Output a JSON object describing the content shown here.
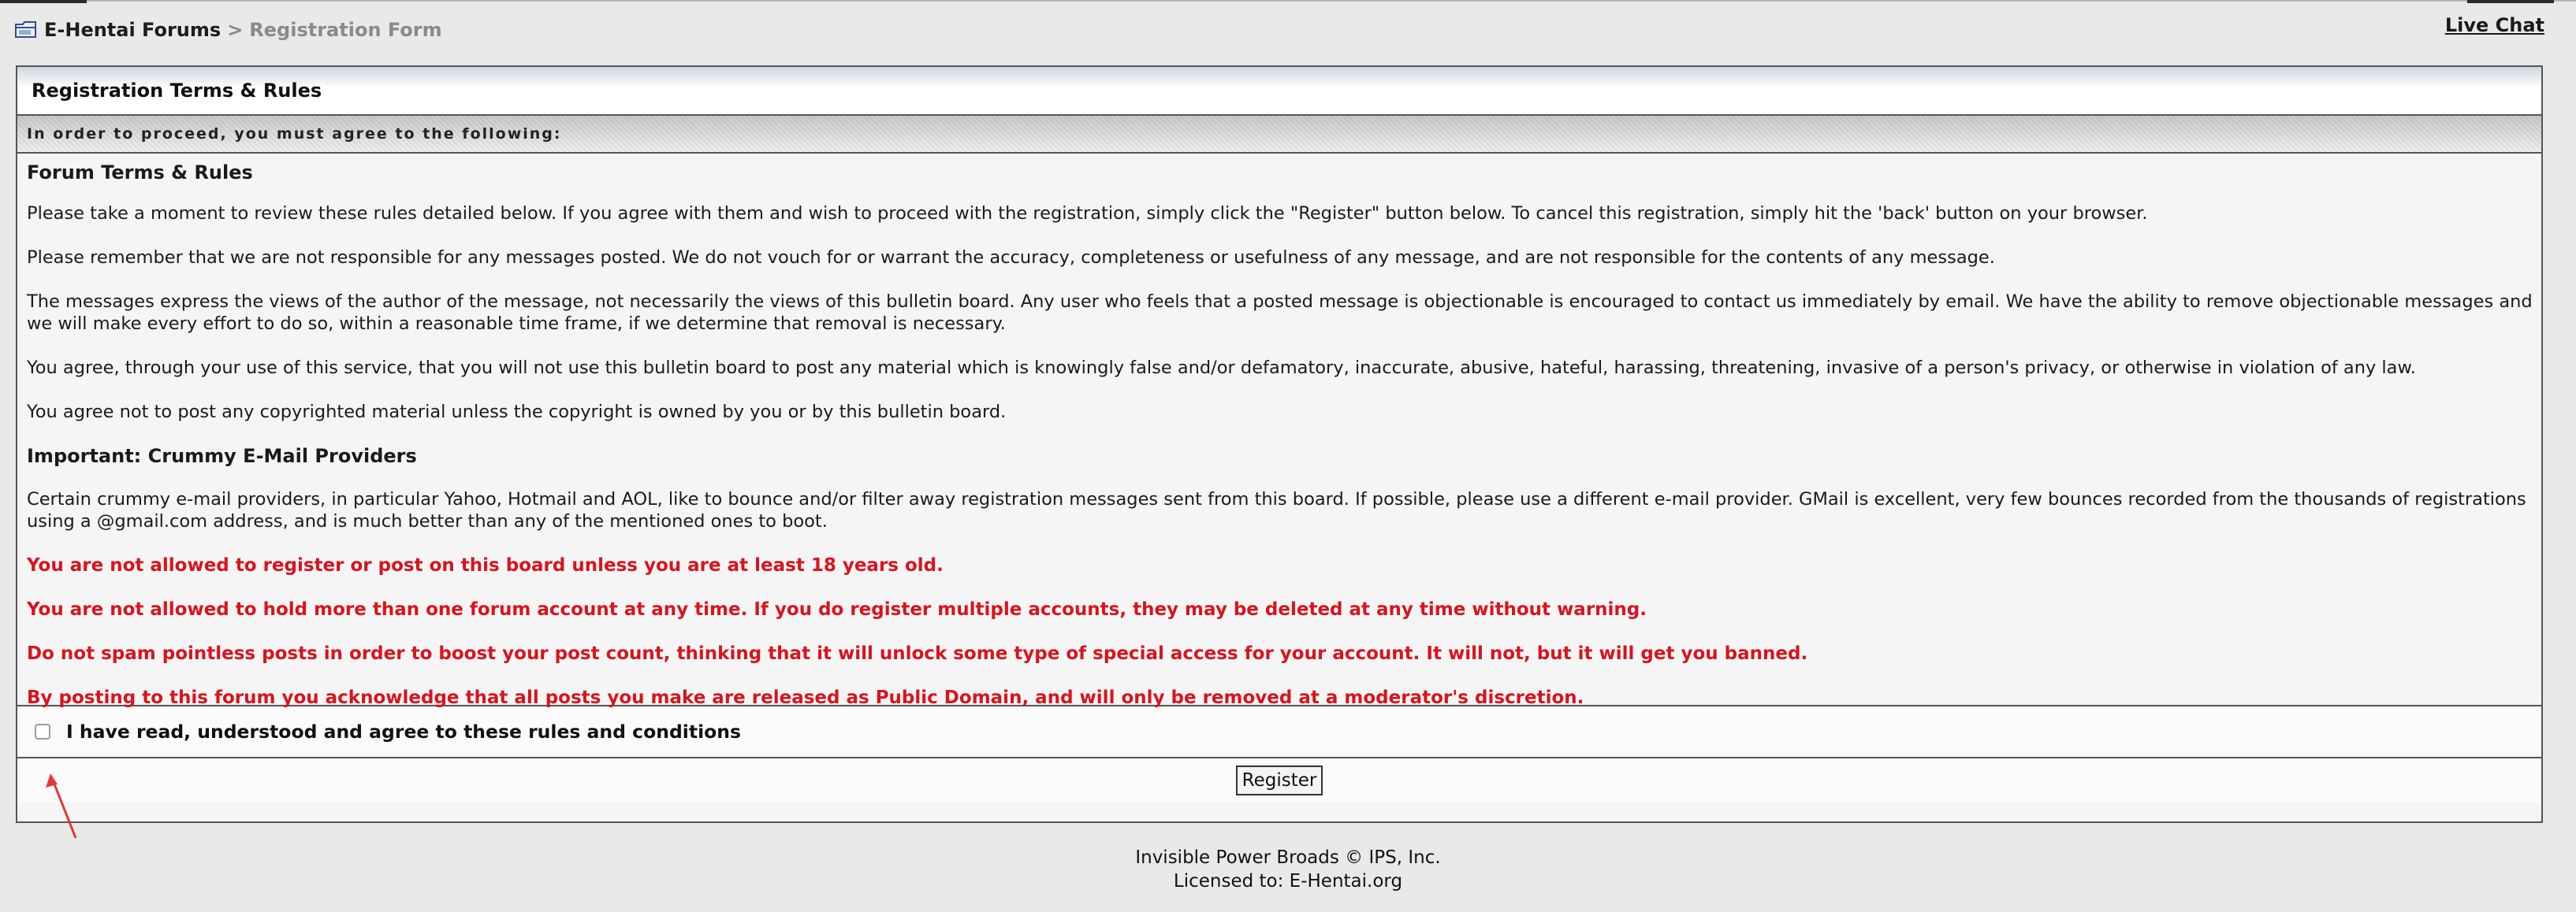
{
  "header": {
    "folder_icon": "folder-icon",
    "breadcrumb_home": "E-Hentai Forums",
    "breadcrumb_separator": ">",
    "breadcrumb_current": "Registration Form",
    "live_chat": "Live Chat"
  },
  "panel": {
    "title": "Registration Terms & Rules",
    "subheading": "In order to proceed, you must agree to the following:",
    "paragraphs": {
      "p0": "Forum Terms & Rules",
      "p1": "Please take a moment to review these rules detailed below. If you agree with them and wish to proceed with the registration, simply click the \"Register\" button below. To cancel this registration, simply hit the 'back' button on your browser.",
      "p2": "Please remember that we are not responsible for any messages posted. We do not vouch for or warrant the accuracy, completeness or usefulness of any message, and are not responsible for the contents of any message.",
      "p3": "The messages express the views of the author of the message, not necessarily the views of this bulletin board. Any user who feels that a posted message is objectionable is encouraged to contact us immediately by email. We have the ability to remove objectionable messages and we will make every effort to do so, within a reasonable time frame, if we determine that removal is necessary.",
      "p4": "You agree, through your use of this service, that you will not use this bulletin board to post any material which is knowingly false and/or defamatory, inaccurate, abusive, hateful, harassing, threatening, invasive of a person's privacy, or otherwise in violation of any law.",
      "p5": "You agree not to post any copyrighted material unless the copyright is owned by you or by this bulletin board.",
      "p6": "Important: Crummy E-Mail Providers",
      "p7": "Certain crummy e-mail providers, in particular Yahoo, Hotmail and AOL, like to bounce and/or filter away registration messages sent from this board. If possible, please use a different e-mail provider. GMail is excellent, very few bounces recorded from the thousands of registrations using a @gmail.com address, and is much better than any of the mentioned ones to boot.",
      "p8": "You are not allowed to register or post on this board unless you are at least 18 years old.",
      "p9": "You are not allowed to hold more than one forum account at any time. If you do register multiple accounts, they may be deleted at any time without warning.",
      "p10": "Do not spam pointless posts in order to boost your post count, thinking that it will unlock some type of special access for your account. It will not, but it will get you banned.",
      "p11": "By posting to this forum you acknowledge that all posts you make are released as Public Domain, and will only be removed at a moderator's discretion."
    },
    "agree_label": "I have read, understood and agree to these rules and conditions",
    "agree_checked": false,
    "register_label": "Register"
  },
  "footer": {
    "line1": "Invisible Power Broads © IPS, Inc.",
    "line2": "Licensed to: E-Hentai.org"
  },
  "colors": {
    "warning_text": "#d8141d",
    "annotation_arrow": "#e53935",
    "page_background": "#e9e9e9",
    "border": "#555555"
  }
}
